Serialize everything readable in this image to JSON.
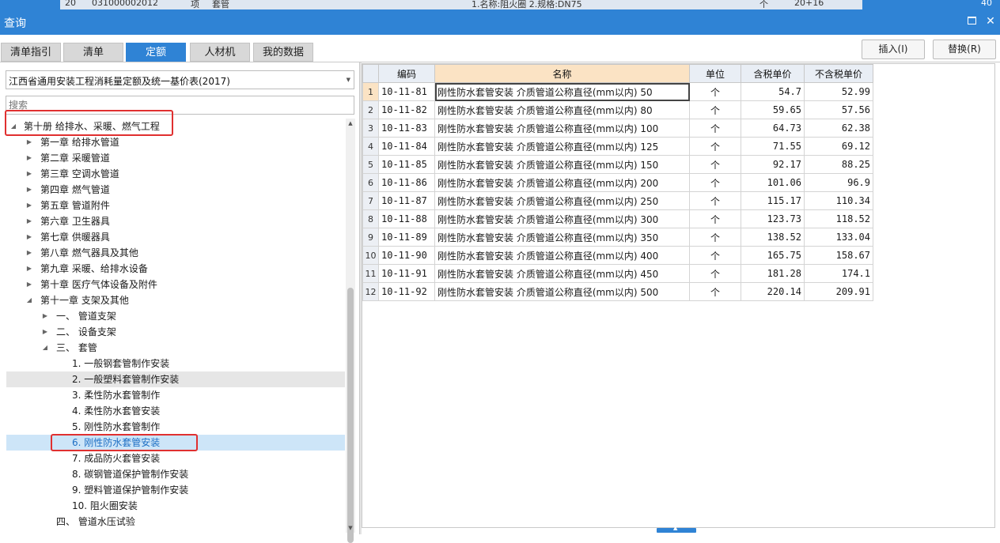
{
  "window": {
    "title": "查询"
  },
  "background": {
    "row_number": "20",
    "code": "031000002012",
    "unit_col": "项",
    "name_col": "套管",
    "desc": "1.名称:阻火圈 2.规格:DN75",
    "unit": "个",
    "qty_text": "20+16",
    "amount": "40"
  },
  "tabs": [
    {
      "label": "清单指引",
      "active": false
    },
    {
      "label": "清单",
      "active": false
    },
    {
      "label": "定额",
      "active": true
    },
    {
      "label": "人材机",
      "active": false
    },
    {
      "label": "我的数据",
      "active": false
    }
  ],
  "buttons": {
    "insert": "插入(I)",
    "replace": "替换(R)"
  },
  "left": {
    "dropdown_value": "江西省通用安装工程消耗量定额及统一基价表(2017)",
    "search_placeholder": "搜索"
  },
  "tree": [
    {
      "label": "第十册 给排水、采暖、燃气工程",
      "level": 0,
      "expander": "open",
      "state": "normal"
    },
    {
      "label": "第一章 给排水管道",
      "level": 1,
      "expander": "closed",
      "state": "normal"
    },
    {
      "label": "第二章 采暖管道",
      "level": 1,
      "expander": "closed",
      "state": "normal"
    },
    {
      "label": "第三章 空调水管道",
      "level": 1,
      "expander": "closed",
      "state": "normal"
    },
    {
      "label": "第四章 燃气管道",
      "level": 1,
      "expander": "closed",
      "state": "normal"
    },
    {
      "label": "第五章 管道附件",
      "level": 1,
      "expander": "closed",
      "state": "normal"
    },
    {
      "label": "第六章 卫生器具",
      "level": 1,
      "expander": "closed",
      "state": "normal"
    },
    {
      "label": "第七章 供暖器具",
      "level": 1,
      "expander": "closed",
      "state": "normal"
    },
    {
      "label": "第八章 燃气器具及其他",
      "level": 1,
      "expander": "closed",
      "state": "normal"
    },
    {
      "label": "第九章 采暖、给排水设备",
      "level": 1,
      "expander": "closed",
      "state": "normal"
    },
    {
      "label": "第十章 医疗气体设备及附件",
      "level": 1,
      "expander": "closed",
      "state": "normal"
    },
    {
      "label": "第十一章 支架及其他",
      "level": 1,
      "expander": "open",
      "state": "normal"
    },
    {
      "label": "一、  管道支架",
      "level": 2,
      "expander": "closed",
      "state": "normal"
    },
    {
      "label": "二、  设备支架",
      "level": 2,
      "expander": "closed",
      "state": "normal"
    },
    {
      "label": "三、  套管",
      "level": 2,
      "expander": "open",
      "state": "normal"
    },
    {
      "label": "1. 一般钢套管制作安装",
      "level": 3,
      "expander": "none",
      "state": "normal"
    },
    {
      "label": "2. 一般塑料套管制作安装",
      "level": 3,
      "expander": "none",
      "state": "hover"
    },
    {
      "label": "3. 柔性防水套管制作",
      "level": 3,
      "expander": "none",
      "state": "normal"
    },
    {
      "label": "4. 柔性防水套管安装",
      "level": 3,
      "expander": "none",
      "state": "normal"
    },
    {
      "label": "5. 刚性防水套管制作",
      "level": 3,
      "expander": "none",
      "state": "normal"
    },
    {
      "label": "6. 刚性防水套管安装",
      "level": 3,
      "expander": "none",
      "state": "selected"
    },
    {
      "label": "7. 成品防火套管安装",
      "level": 3,
      "expander": "none",
      "state": "normal"
    },
    {
      "label": "8. 碳钢管道保护管制作安装",
      "level": 3,
      "expander": "none",
      "state": "normal"
    },
    {
      "label": "9. 塑料管道保护管制作安装",
      "level": 3,
      "expander": "none",
      "state": "normal"
    },
    {
      "label": "10. 阻火圈安装",
      "level": 3,
      "expander": "none",
      "state": "normal"
    },
    {
      "label": "四、  管道水压试验",
      "level": 2,
      "expander": "none",
      "state": "normal"
    }
  ],
  "grid": {
    "headers": {
      "code": "编码",
      "name": "名称",
      "unit": "单位",
      "price_tax": "含税单价",
      "price_notax": "不含税单价"
    },
    "rows": [
      {
        "n": "1",
        "code": "10-11-81",
        "name": "刚性防水套管安装 介质管道公称直径(mm以内) 50",
        "unit": "个",
        "price_tax": "54.7",
        "price_notax": "52.99"
      },
      {
        "n": "2",
        "code": "10-11-82",
        "name": "刚性防水套管安装 介质管道公称直径(mm以内) 80",
        "unit": "个",
        "price_tax": "59.65",
        "price_notax": "57.56"
      },
      {
        "n": "3",
        "code": "10-11-83",
        "name": "刚性防水套管安装 介质管道公称直径(mm以内) 100",
        "unit": "个",
        "price_tax": "64.73",
        "price_notax": "62.38"
      },
      {
        "n": "4",
        "code": "10-11-84",
        "name": "刚性防水套管安装 介质管道公称直径(mm以内) 125",
        "unit": "个",
        "price_tax": "71.55",
        "price_notax": "69.12"
      },
      {
        "n": "5",
        "code": "10-11-85",
        "name": "刚性防水套管安装 介质管道公称直径(mm以内) 150",
        "unit": "个",
        "price_tax": "92.17",
        "price_notax": "88.25"
      },
      {
        "n": "6",
        "code": "10-11-86",
        "name": "刚性防水套管安装 介质管道公称直径(mm以内) 200",
        "unit": "个",
        "price_tax": "101.06",
        "price_notax": "96.9"
      },
      {
        "n": "7",
        "code": "10-11-87",
        "name": "刚性防水套管安装 介质管道公称直径(mm以内) 250",
        "unit": "个",
        "price_tax": "115.17",
        "price_notax": "110.34"
      },
      {
        "n": "8",
        "code": "10-11-88",
        "name": "刚性防水套管安装 介质管道公称直径(mm以内) 300",
        "unit": "个",
        "price_tax": "123.73",
        "price_notax": "118.52"
      },
      {
        "n": "9",
        "code": "10-11-89",
        "name": "刚性防水套管安装 介质管道公称直径(mm以内) 350",
        "unit": "个",
        "price_tax": "138.52",
        "price_notax": "133.04"
      },
      {
        "n": "10",
        "code": "10-11-90",
        "name": "刚性防水套管安装 介质管道公称直径(mm以内) 400",
        "unit": "个",
        "price_tax": "165.75",
        "price_notax": "158.67"
      },
      {
        "n": "11",
        "code": "10-11-91",
        "name": "刚性防水套管安装 介质管道公称直径(mm以内) 450",
        "unit": "个",
        "price_tax": "181.28",
        "price_notax": "174.1"
      },
      {
        "n": "12",
        "code": "10-11-92",
        "name": "刚性防水套管安装 介质管道公称直径(mm以内) 500",
        "unit": "个",
        "price_tax": "220.14",
        "price_notax": "209.91"
      }
    ]
  },
  "colors": {
    "accent": "#2f83d5",
    "highlight_outline": "#e03030",
    "selected_row": "#cde5f8",
    "header_name": "#fbe3c4"
  },
  "icons": {
    "maximize": "maximize-icon",
    "close": "close-icon",
    "dropdown": "chevron-down-icon",
    "tree_open": "triangle-down-icon",
    "tree_closed": "triangle-right-icon"
  }
}
